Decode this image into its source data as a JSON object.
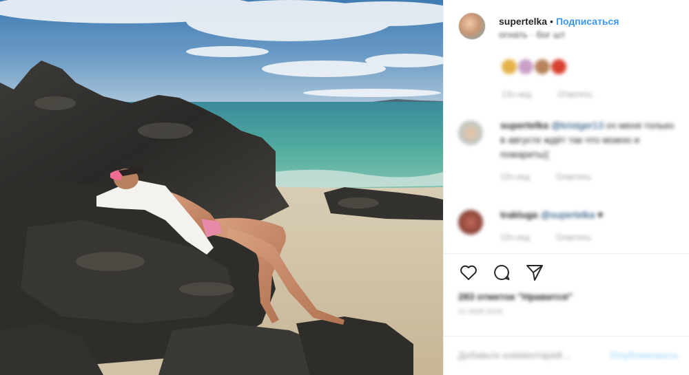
{
  "post": {
    "username": "supertelka",
    "separator": "•",
    "follow_label": "Подписаться",
    "caption": "огнать · бог шт"
  },
  "comments": [
    {
      "username": "",
      "text": "",
      "meta_time": "13ч нед",
      "meta_reply": "Ответить"
    },
    {
      "username": "supertelka",
      "mention": "@kristger13",
      "text": "оч меня только в августе ждёт так что можно и пожарить((",
      "meta_time": "13ч нед",
      "meta_reply": "Ответить"
    },
    {
      "username": "trakluga",
      "mention": "@supertelka",
      "text": "♥",
      "meta_time": "13ч нед",
      "meta_reply": "Ответить"
    }
  ],
  "likes": "283 отметок \"Нравится\"",
  "date": "21 НОЯ 2019",
  "add_comment": {
    "placeholder": "Добавьте комментарий...",
    "post_label": "Опубликовать"
  },
  "icons": {
    "like": "heart-outline-icon",
    "comment": "speech-bubble-icon",
    "share": "paper-plane-icon"
  },
  "colors": {
    "follow": "#3897f0",
    "text": "#262626",
    "muted": "#999999",
    "border": "#efefef"
  }
}
